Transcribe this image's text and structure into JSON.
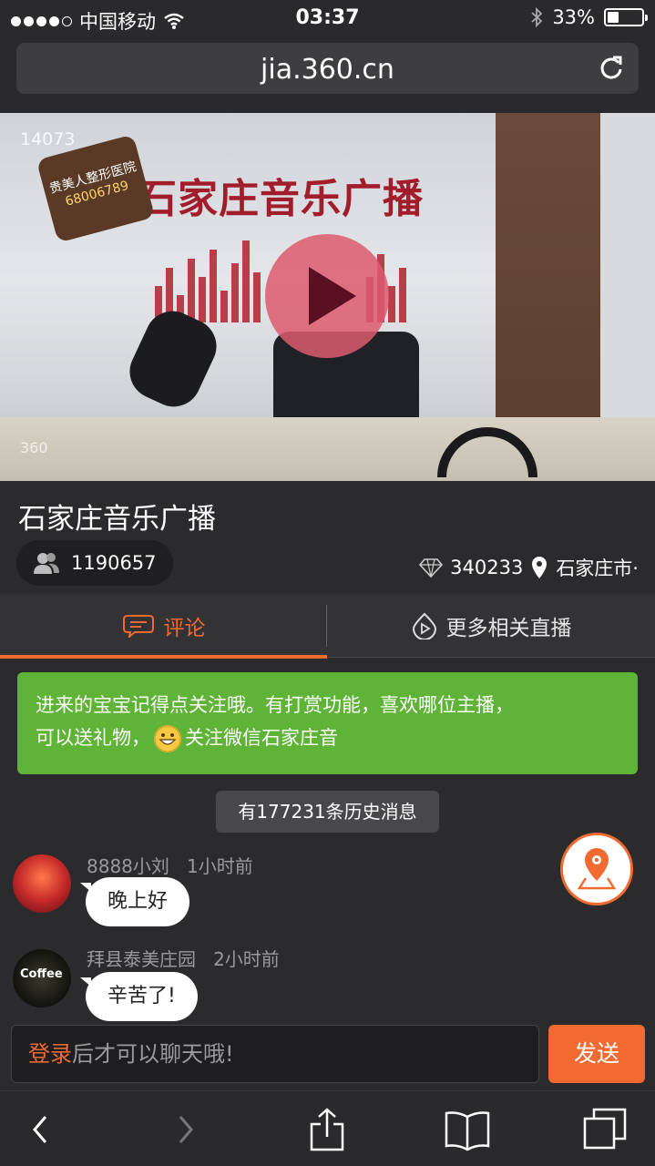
{
  "status_bar": {
    "carrier": "中国移动",
    "time": "03:37",
    "battery_percent_text": "33%",
    "battery_level": 0.33
  },
  "browser": {
    "url": "jia.360.cn"
  },
  "video": {
    "view_count": "14073",
    "station_sign": "石家庄音乐广播",
    "ad_line1": "贵美人整形医院",
    "ad_phone": "68006789",
    "watermark": "360"
  },
  "channel": {
    "title": "石家庄音乐广播",
    "viewers": "1190657",
    "diamonds": "340233",
    "location": "石家庄市·"
  },
  "tabs": [
    {
      "label": "评论",
      "active": true
    },
    {
      "label": "更多相关直播",
      "active": false
    }
  ],
  "notice": {
    "line1": "进来的宝宝记得点关注哦。有打赏功能，喜欢哪位主播，",
    "line2_before": "可以送礼物，",
    "line2_after": "关注微信石家庄音"
  },
  "history": {
    "label": "有177231条历史消息"
  },
  "messages": [
    {
      "user": "8888小刘",
      "time": "1小时前",
      "text": "晚上好"
    },
    {
      "user": "拜县泰美庄园",
      "time": "2小时前",
      "text": "辛苦了!",
      "avatar_text": "Coffee"
    }
  ],
  "chat": {
    "login_label": "登录",
    "placeholder_rest": "后才可以聊天哦!",
    "send_label": "发送"
  },
  "colors": {
    "accent": "#f06a32",
    "notice_green": "#5fb336",
    "background": "#2b2b2d"
  },
  "icons": [
    "wifi-icon",
    "bluetooth-icon",
    "reload-icon",
    "play-icon",
    "people-icon",
    "diamond-icon",
    "location-icon",
    "chat-icon",
    "play-circle-icon",
    "map-pin-icon",
    "back-icon",
    "forward-icon",
    "share-icon",
    "bookmarks-icon",
    "tabs-icon"
  ]
}
